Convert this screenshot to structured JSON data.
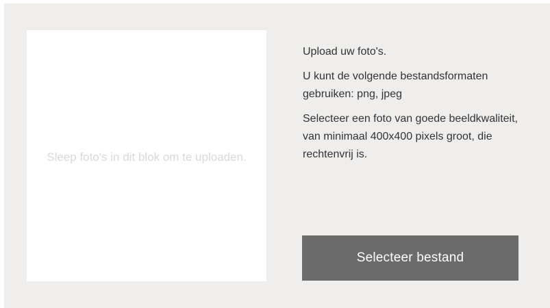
{
  "upload": {
    "dropzone_text": "Sleep foto's in dit blok om te uploaden.",
    "intro": "Upload uw foto's.",
    "formats": "U kunt de volgende bestandsformaten gebruiken: png, jpeg",
    "quality": "Selecteer een foto van goede beeldkwaliteit, van minimaal 400x400 pixels groot, die rechtenvrij is.",
    "button_label": "Selecteer bestand"
  },
  "colors": {
    "panel_background": "#efeeec",
    "dropzone_background": "#ffffff",
    "dropzone_text": "#d9d9d9",
    "body_text": "#333333",
    "button_background": "#6b6b6b",
    "button_text": "#ffffff"
  }
}
